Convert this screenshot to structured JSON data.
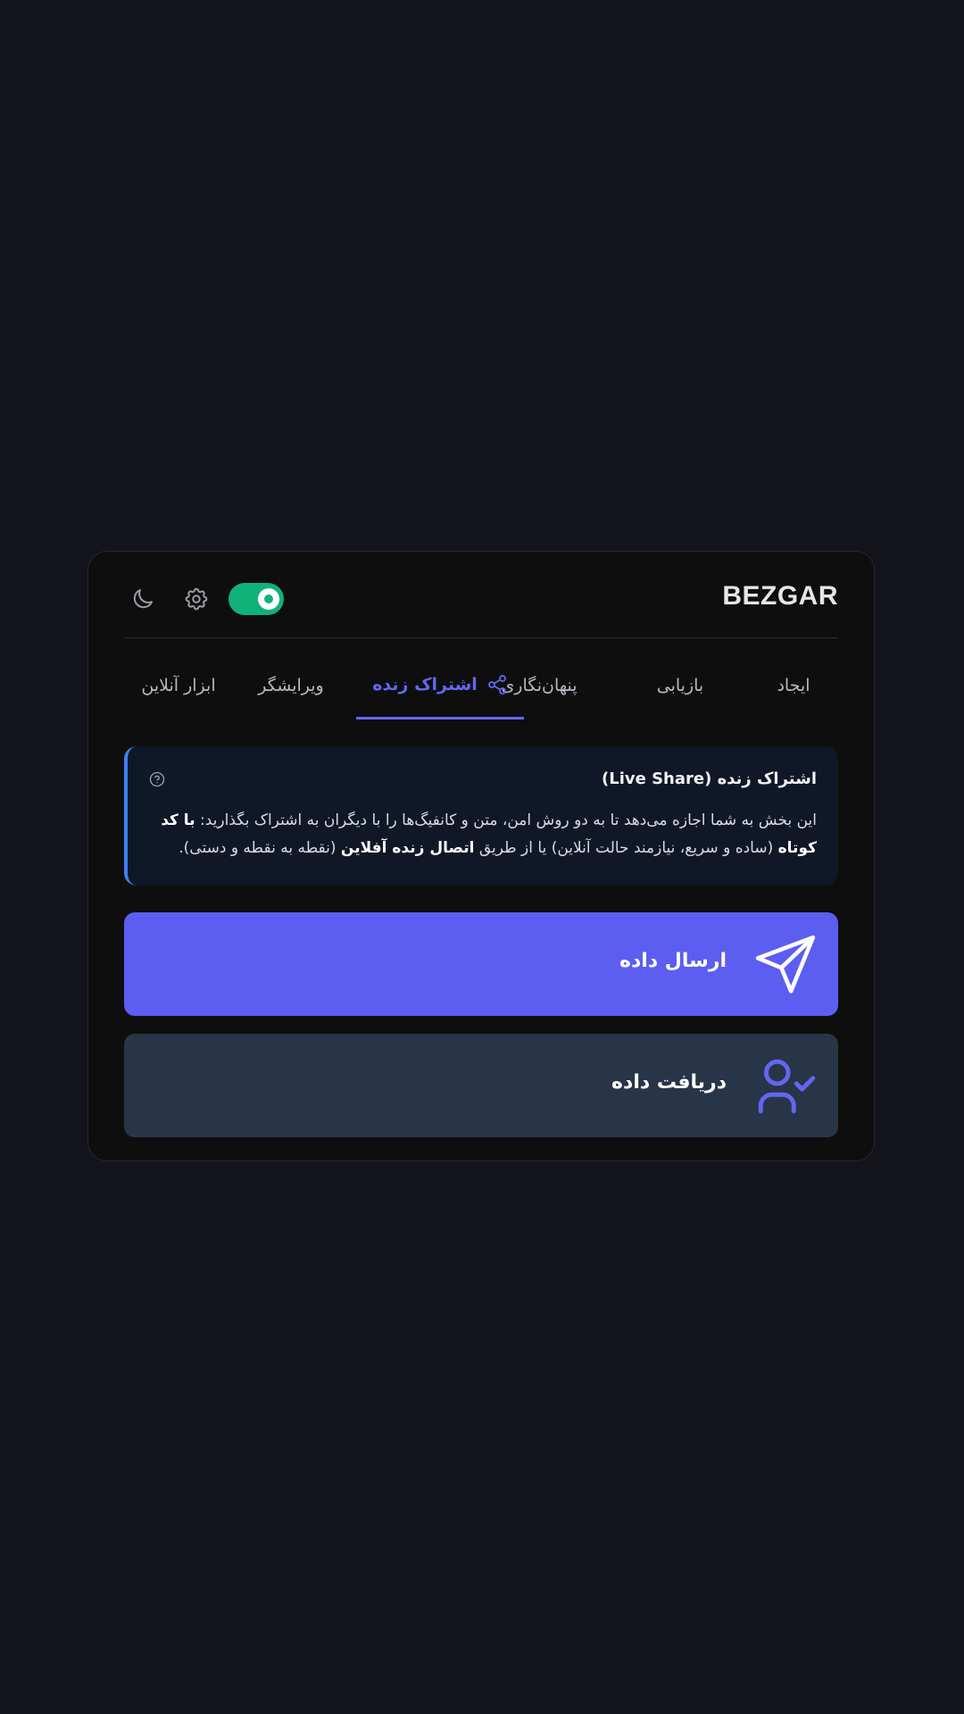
{
  "header": {
    "logo": "BEZGAR",
    "toggle_on": true,
    "toggle_color": "#10b27a"
  },
  "tabs": [
    {
      "label": "ایجاد",
      "active": false
    },
    {
      "label": "بازیابی",
      "active": false
    },
    {
      "label": "پنهان‌نگاری",
      "active": false
    },
    {
      "label": "اشتراک زنده",
      "active": true,
      "icon": "share-icon"
    },
    {
      "label": "ویرایشگر",
      "active": false
    },
    {
      "label": "ابزار آنلاین",
      "active": false
    }
  ],
  "info": {
    "title": "اشتراک زنده (Live Share)",
    "body_part1": "این بخش به شما اجازه می‌دهد تا به دو روش امن، متن و کانفیگ‌ها را با دیگران به اشتراک بگذارید: ",
    "body_bold1": "با کد کوتاه",
    "body_part2": " (ساده و سریع، نیازمند حالت آنلاین) یا از طریق ",
    "body_bold2": "اتصال زنده آفلاین",
    "body_part3": " (نقطه به نقطه و دستی)."
  },
  "actions": {
    "send_label": "ارسال داده",
    "receive_label": "دریافت داده"
  },
  "colors": {
    "accent": "#6366f1",
    "send_bg": "#5b5ef1",
    "receive_bg": "#283548",
    "info_border": "#3b82f6"
  }
}
